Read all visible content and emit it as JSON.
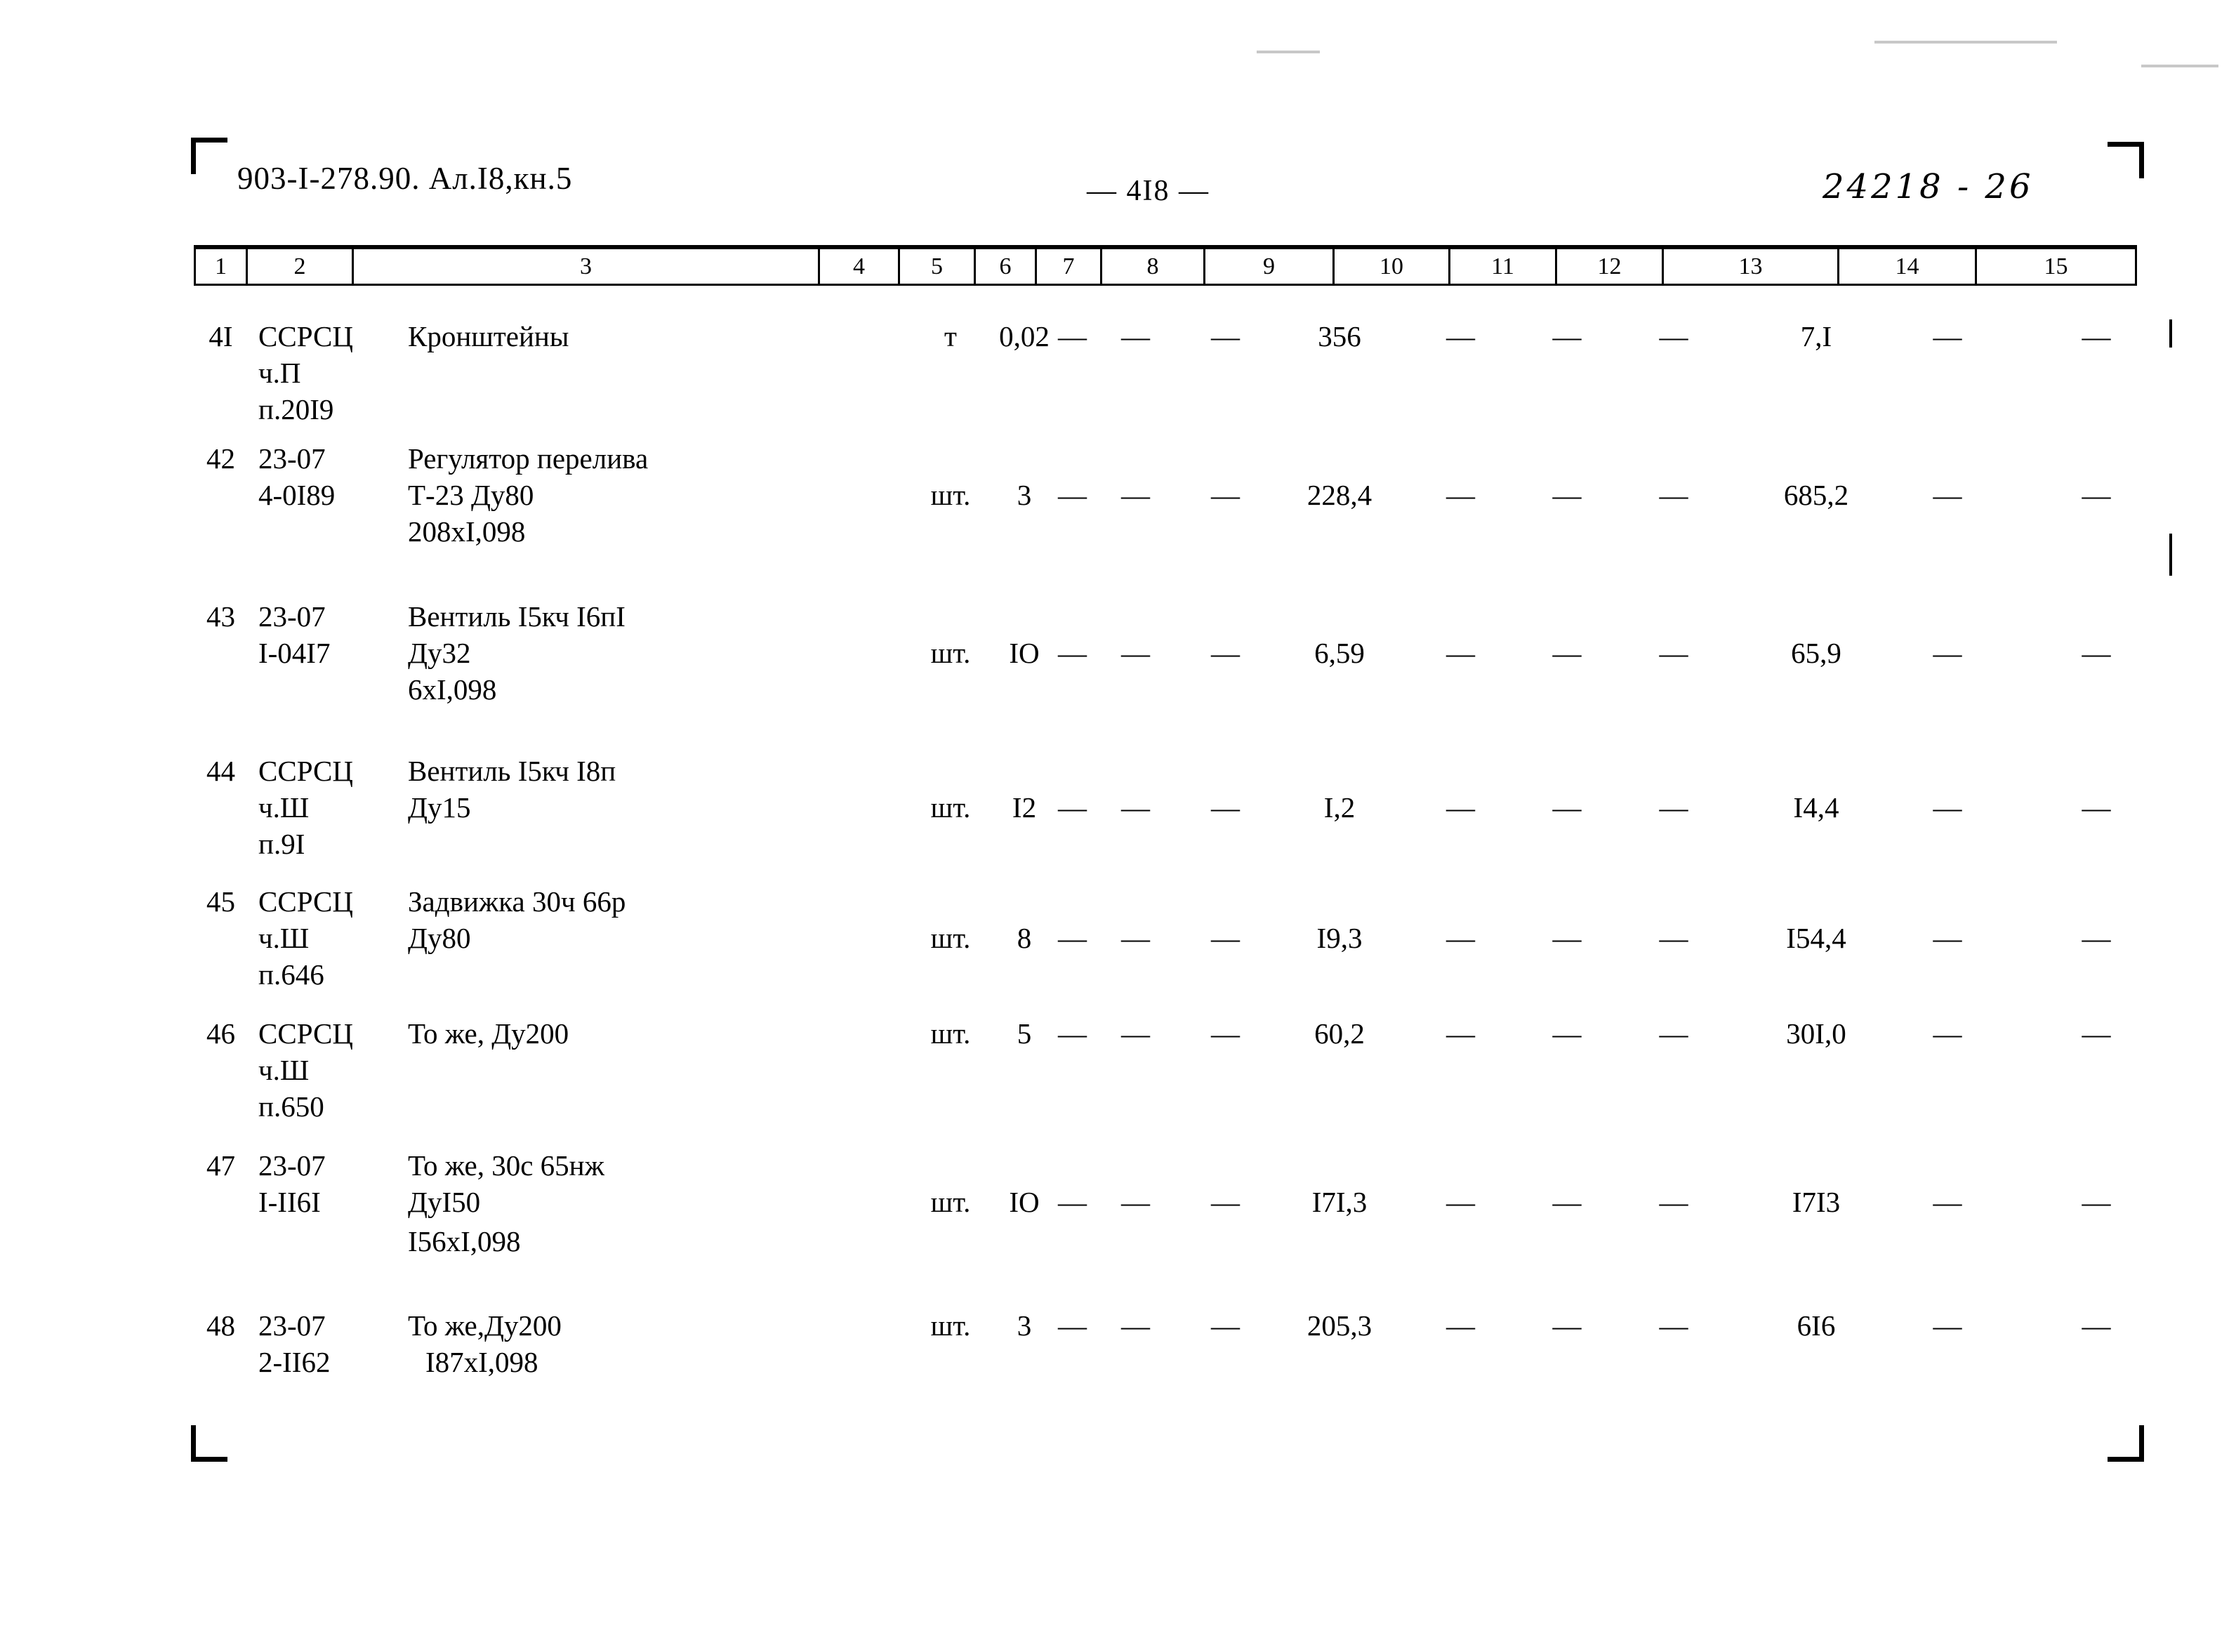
{
  "header": {
    "doc_code": "903-I-278.90.  Ал.I8,кн.5",
    "page_number": "— 4I8 —",
    "archive_number": "24218 - 26"
  },
  "table": {
    "column_headers": [
      "1",
      "2",
      "3",
      "4",
      "5",
      "6",
      "7",
      "8",
      "9",
      "10",
      "11",
      "12",
      "13",
      "14",
      "15"
    ],
    "dash_glyph": "—",
    "rows": [
      {
        "num": "4I",
        "code": "ССРСЦ\nч.П\nп.20I9",
        "name": "Кронштейны",
        "name2": "",
        "unit": "т",
        "qty": "0,02",
        "c6": "—",
        "c7": "—",
        "c8": "—",
        "c9": "356",
        "c10": "—",
        "c11": "—",
        "c12": "—",
        "c13": "7,I",
        "c14": "—",
        "c15": "—"
      },
      {
        "num": "42",
        "code": "23-07\n4-0I89",
        "name": "Регулятор перелива\nТ-23 Ду80",
        "name2": "208xI,098",
        "unit": "шт.",
        "qty": "3",
        "c6": "—",
        "c7": "—",
        "c8": "—",
        "c9": "228,4",
        "c10": "—",
        "c11": "—",
        "c12": "—",
        "c13": "685,2",
        "c14": "—",
        "c15": "—"
      },
      {
        "num": "43",
        "code": "23-07\nI-04I7",
        "name": "Вентиль I5кч I6пI\nДу32",
        "name2": "6xI,098",
        "unit": "шт.",
        "qty": "IO",
        "c6": "—",
        "c7": "—",
        "c8": "—",
        "c9": "6,59",
        "c10": "—",
        "c11": "—",
        "c12": "—",
        "c13": "65,9",
        "c14": "—",
        "c15": "—"
      },
      {
        "num": "44",
        "code": "ССРСЦ\nч.Ш\nп.9I",
        "name": "Вентиль I5кч I8п\nДу15",
        "name2": "",
        "unit": "шт.",
        "qty": "I2",
        "c6": "—",
        "c7": "—",
        "c8": "—",
        "c9": "I,2",
        "c10": "—",
        "c11": "—",
        "c12": "—",
        "c13": "I4,4",
        "c14": "—",
        "c15": "—"
      },
      {
        "num": "45",
        "code": "ССРСЦ\nч.Ш\nп.646",
        "name": "Задвижка 30ч 66р\nДу80",
        "name2": "",
        "unit": "шт.",
        "qty": "8",
        "c6": "—",
        "c7": "—",
        "c8": "—",
        "c9": "I9,3",
        "c10": "—",
        "c11": "—",
        "c12": "—",
        "c13": "I54,4",
        "c14": "—",
        "c15": "—"
      },
      {
        "num": "46",
        "code": "ССРСЦ\nч.Ш\nп.650",
        "name": "То же, Ду200",
        "name2": "",
        "unit": "шт.",
        "qty": "5",
        "c6": "—",
        "c7": "—",
        "c8": "—",
        "c9": "60,2",
        "c10": "—",
        "c11": "—",
        "c12": "—",
        "c13": "30I,0",
        "c14": "—",
        "c15": "—"
      },
      {
        "num": "47",
        "code": "23-07\nI-II6I",
        "name": "То же, 30с 65нж\nДуI50",
        "name2": "I56xI,098",
        "unit": "шт.",
        "qty": "IO",
        "c6": "—",
        "c7": "—",
        "c8": "—",
        "c9": "I7I,3",
        "c10": "—",
        "c11": "—",
        "c12": "—",
        "c13": "I7I3",
        "c14": "—",
        "c15": "—"
      },
      {
        "num": "48",
        "code": "23-07\n2-II62",
        "name": "То же,Ду200",
        "name2": "I87xI,098",
        "unit": "шт.",
        "qty": "3",
        "c6": "—",
        "c7": "—",
        "c8": "—",
        "c9": "205,3",
        "c10": "—",
        "c11": "—",
        "c12": "—",
        "c13": "6I6",
        "c14": "—",
        "c15": "—"
      }
    ]
  }
}
